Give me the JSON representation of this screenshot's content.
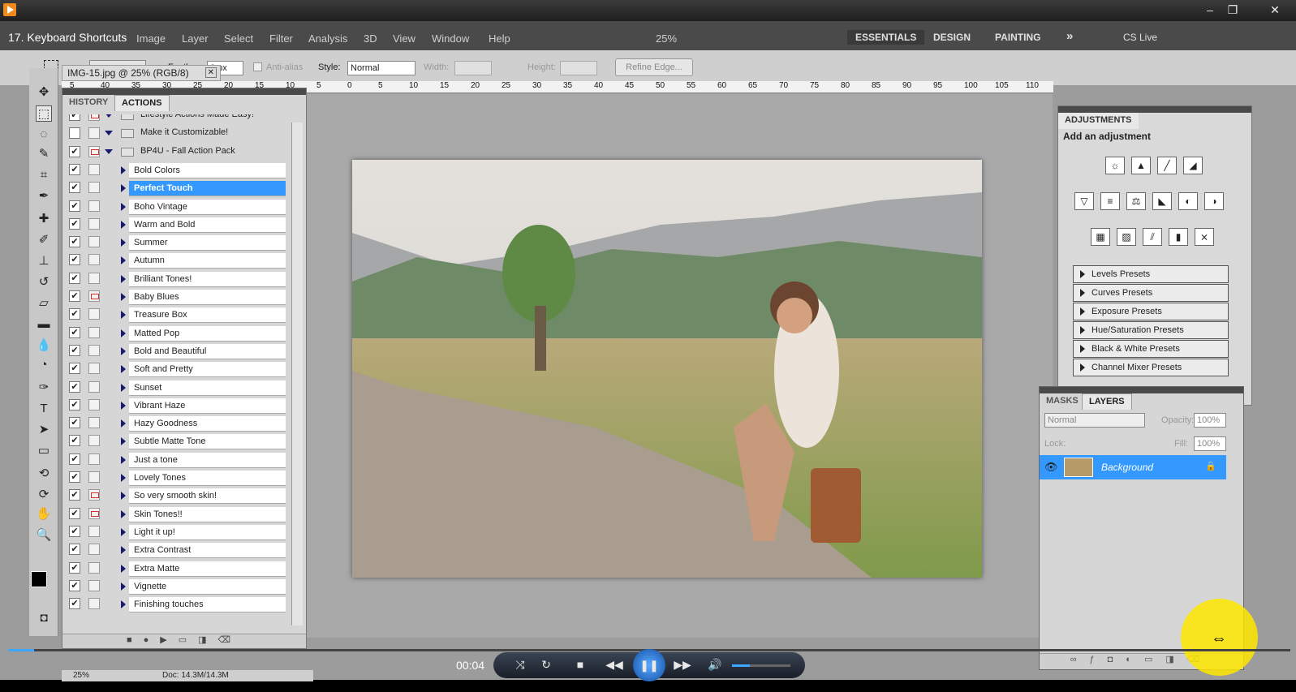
{
  "player": {
    "title": "17. Keyboard Shortcuts",
    "time": "00:04",
    "progress": 0.02,
    "volume": 0.3,
    "controls": {
      "shuffle": "⤨",
      "repeat": "↻",
      "stop": "■",
      "prev": "◀◀",
      "pause": "❚❚",
      "next": "▶▶",
      "volume_icon": "🔊"
    },
    "win": {
      "min": "–",
      "max": "❐",
      "close": "✕"
    }
  },
  "ps": {
    "menus": [
      "Image",
      "Layer",
      "Select",
      "Filter",
      "Analysis",
      "3D",
      "View",
      "Window",
      "Help"
    ],
    "zoom_menu": "25%",
    "workspaces": [
      "ESSENTIALS",
      "DESIGN",
      "PAINTING"
    ],
    "more": "»",
    "cslive": "CS Live",
    "options": {
      "feather_label": "Feather:",
      "feather_value": "0 px",
      "antialias_label": "Anti-alias",
      "style_label": "Style:",
      "style_value": "Normal",
      "width_label": "Width:",
      "height_label": "Height:",
      "refine": "Refine Edge..."
    },
    "doc_tab": "IMG-15.jpg @ 25% (RGB/8)",
    "ruler_ticks": [
      "5",
      "40",
      "35",
      "30",
      "25",
      "20",
      "15",
      "10",
      "5",
      "0",
      "5",
      "10",
      "15",
      "20",
      "25",
      "30",
      "35",
      "40",
      "45",
      "50",
      "55",
      "60",
      "65",
      "70",
      "75",
      "80",
      "85",
      "90",
      "95",
      "100",
      "105",
      "110"
    ],
    "status": {
      "zoom": "25%",
      "doc": "Doc: 14.3M/14.3M"
    }
  },
  "actions_panel": {
    "tabs": [
      "HISTORY",
      "ACTIONS"
    ],
    "header_rows": [
      {
        "name": "Lifestyle Actions Made Easy!",
        "check": "✔",
        "dialog": true,
        "folder": true
      },
      {
        "name": "Make it Customizable!",
        "check": "",
        "dialog": false,
        "folder": true
      },
      {
        "name": "BP4U - Fall Action Pack",
        "check": "✔",
        "dialog": true,
        "folder": true
      }
    ],
    "items": [
      {
        "name": "Bold Colors",
        "dialog": false
      },
      {
        "name": "Perfect Touch",
        "dialog": false,
        "selected": true
      },
      {
        "name": "Boho Vintage",
        "dialog": false
      },
      {
        "name": "Warm and Bold",
        "dialog": false
      },
      {
        "name": "Summer",
        "dialog": false
      },
      {
        "name": "Autumn",
        "dialog": false
      },
      {
        "name": "Brilliant Tones!",
        "dialog": false
      },
      {
        "name": "Baby Blues",
        "dialog": true
      },
      {
        "name": "Treasure Box",
        "dialog": false
      },
      {
        "name": "Matted Pop",
        "dialog": false
      },
      {
        "name": "Bold and Beautiful",
        "dialog": false
      },
      {
        "name": "Soft and Pretty",
        "dialog": false
      },
      {
        "name": "Sunset",
        "dialog": false
      },
      {
        "name": "Vibrant Haze",
        "dialog": false
      },
      {
        "name": "Hazy Goodness",
        "dialog": false
      },
      {
        "name": "Subtle Matte Tone",
        "dialog": false
      },
      {
        "name": "Just a tone",
        "dialog": false
      },
      {
        "name": "Lovely Tones",
        "dialog": false
      },
      {
        "name": "So very smooth skin!",
        "dialog": true
      },
      {
        "name": "Skin Tones!!",
        "dialog": true
      },
      {
        "name": "Light it up!",
        "dialog": false
      },
      {
        "name": "Extra Contrast",
        "dialog": false
      },
      {
        "name": "Extra Matte",
        "dialog": false
      },
      {
        "name": "Vignette",
        "dialog": false
      },
      {
        "name": "Finishing touches",
        "dialog": false
      }
    ]
  },
  "adjustments": {
    "tab": "ADJUSTMENTS",
    "subtitle": "Add an adjustment",
    "icon_rows": [
      [
        "☼",
        "▲",
        "╱",
        "◢"
      ],
      [
        "▽",
        "≡",
        "⚖",
        "◣",
        "◐",
        "◑"
      ],
      [
        "▦",
        "▨",
        "⫽",
        "▮",
        "⨯"
      ]
    ],
    "presets": [
      "Levels Presets",
      "Curves Presets",
      "Exposure Presets",
      "Hue/Saturation Presets",
      "Black & White Presets",
      "Channel Mixer Presets"
    ]
  },
  "layers": {
    "tabs": [
      "MASKS",
      "LAYERS"
    ],
    "blend": "Normal",
    "opacity_label": "Opacity:",
    "opacity": "100%",
    "lock_label": "Lock:",
    "fill_label": "Fill:",
    "fill": "100%",
    "layer_name": "Background"
  }
}
